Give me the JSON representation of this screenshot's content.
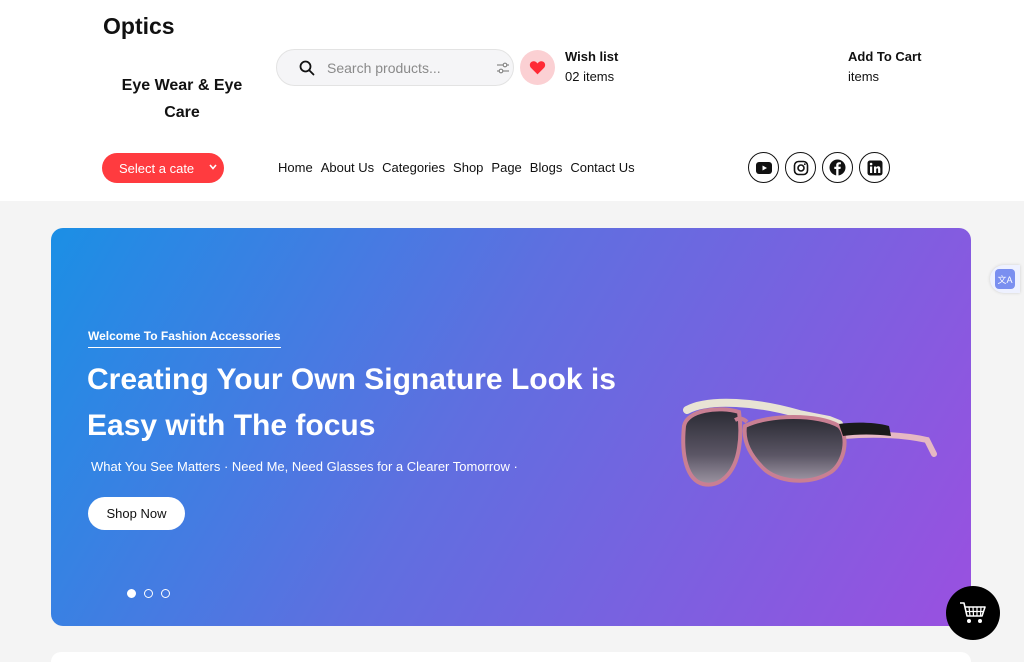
{
  "header": {
    "site_title": "Optics",
    "tagline": "Eye Wear & Eye Care",
    "search": {
      "placeholder": "Search products..."
    },
    "wishlist": {
      "title": "Wish list",
      "count": "02 items"
    },
    "cart": {
      "title": "Add To Cart",
      "count": "items"
    },
    "category_select": {
      "label": "Select a cate"
    },
    "nav": [
      "Home",
      "About Us",
      "Categories",
      "Shop",
      "Page",
      "Blogs",
      "Contact Us"
    ],
    "socials": [
      "youtube-icon",
      "instagram-icon",
      "facebook-icon",
      "linkedin-icon"
    ]
  },
  "hero": {
    "kicker": "Welcome To Fashion Accessories",
    "title": "Creating Your Own Signature Look is Easy with The focus",
    "subtitle": "What You See Matters · Need Me, Need Glasses for a Clearer Tomorrow ·",
    "button_label": "Shop Now",
    "slides": 3,
    "active_slide": 1
  },
  "colors": {
    "accent_red": "#ff3b3f",
    "hero_gradient_start": "#1b8fe5",
    "hero_gradient_end": "#9a50e0"
  }
}
